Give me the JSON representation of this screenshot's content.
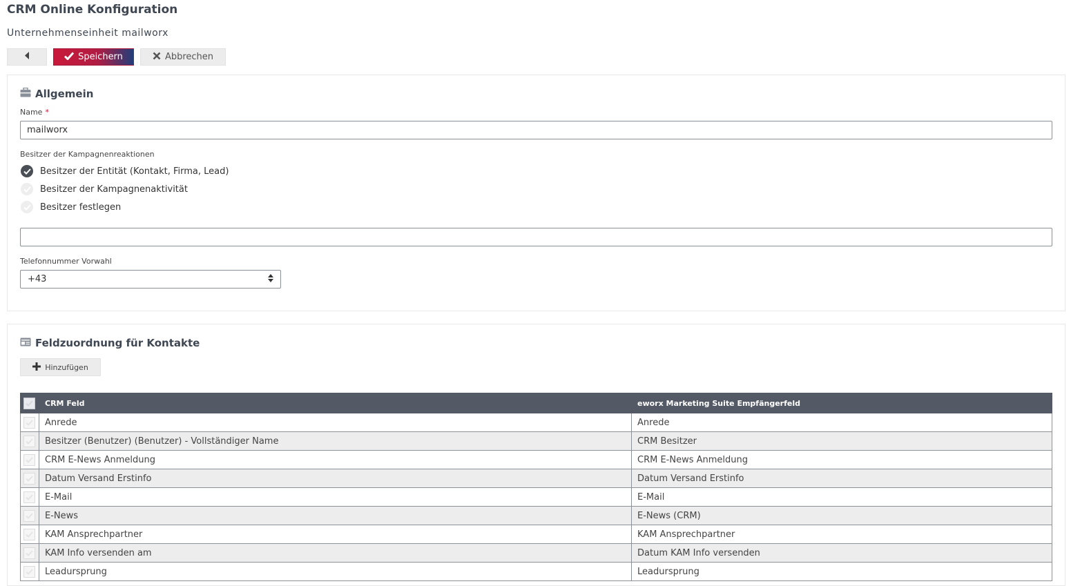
{
  "page": {
    "title": "CRM Online Konfiguration",
    "subtitle": "Unternehmenseinheit mailworx"
  },
  "toolbar": {
    "save_label": "Speichern",
    "cancel_label": "Abbrechen"
  },
  "general": {
    "title": "Allgemein",
    "name_label": "Name",
    "name_required_mark": "*",
    "name_value": "mailworx",
    "owner_label": "Besitzer der Kampagnenreaktionen",
    "owner_options": [
      {
        "label": "Besitzer der Entität (Kontakt, Firma, Lead)",
        "selected": true
      },
      {
        "label": "Besitzer der Kampagnenaktivität",
        "selected": false
      },
      {
        "label": "Besitzer festlegen",
        "selected": false
      }
    ],
    "owner_value": "",
    "phone_label": "Telefonnummer Vorwahl",
    "phone_value": "+43"
  },
  "mapping": {
    "title": "Feldzuordnung für Kontakte",
    "add_label": "Hinzufügen",
    "columns": [
      "CRM Feld",
      "eworx Marketing Suite Empfängerfeld"
    ],
    "rows": [
      [
        "Anrede",
        "Anrede"
      ],
      [
        "Besitzer (Benutzer) (Benutzer) - Vollständiger Name",
        "CRM Besitzer"
      ],
      [
        "CRM E-News Anmeldung",
        "CRM E-News Anmeldung"
      ],
      [
        "Datum Versand Erstinfo",
        "Datum Versand Erstinfo"
      ],
      [
        "E-Mail",
        "E-Mail"
      ],
      [
        "E-News",
        "E-News (CRM)"
      ],
      [
        "KAM Ansprechpartner",
        "KAM Ansprechpartner"
      ],
      [
        "KAM Info versenden am",
        "Datum KAM Info versenden"
      ],
      [
        "Leadursprung",
        "Leadursprung"
      ]
    ]
  },
  "colors": {
    "accent_red": "#c9193a",
    "accent_blue": "#223e7a",
    "table_header": "#535a66"
  }
}
